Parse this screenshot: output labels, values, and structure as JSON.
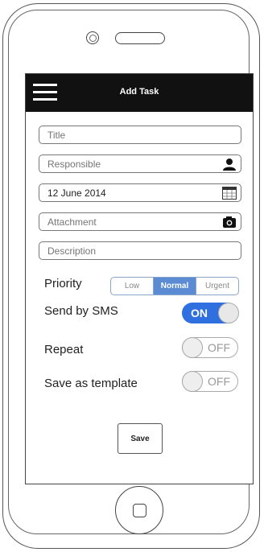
{
  "header": {
    "title": "Add Task"
  },
  "form": {
    "title_placeholder": "Title",
    "responsible_placeholder": "Responsible",
    "date_value": "12 June 2014",
    "attachment_placeholder": "Attachment",
    "description_placeholder": "Description"
  },
  "priority": {
    "label": "Priority",
    "options": [
      "Low",
      "Normal",
      "Urgent"
    ],
    "selected": "Normal"
  },
  "sms": {
    "label": "Send by SMS",
    "state": "ON"
  },
  "repeat": {
    "label": "Repeat",
    "state": "OFF"
  },
  "template": {
    "label": "Save as template",
    "state": "OFF"
  },
  "actions": {
    "save_label": "Save"
  },
  "icons": {
    "menu": "hamburger-menu-icon",
    "responsible": "person-icon",
    "date": "calendar-icon",
    "attachment": "camera-icon"
  },
  "colors": {
    "titlebar": "#111111",
    "accent": "#2f6fe0",
    "segment_active": "#5b8bd3"
  }
}
